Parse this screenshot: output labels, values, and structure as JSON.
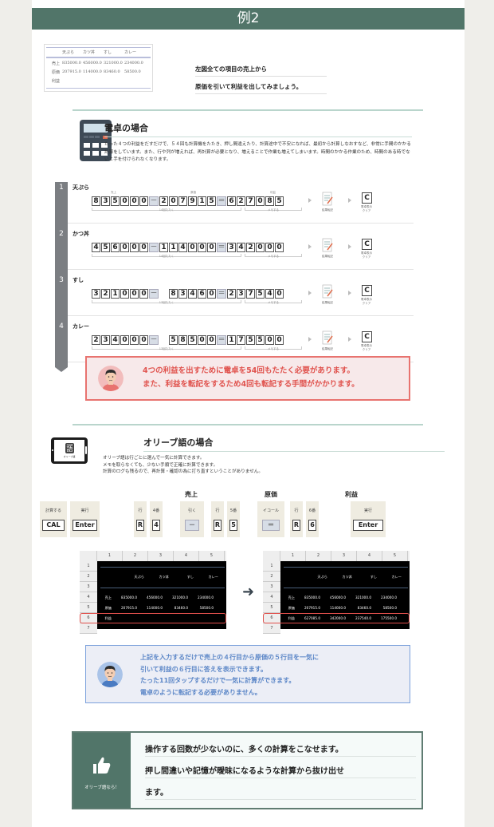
{
  "banner": {
    "title": "例2"
  },
  "intro": {
    "mini_table": {
      "headers": [
        "",
        "天ぷら",
        "カツ丼",
        "すし",
        "カレー"
      ],
      "rows": [
        [
          "売上",
          "835000.0",
          "456000.0",
          "321000.0",
          "234000.0"
        ],
        [
          "原価",
          "207915.0",
          "114000.0",
          "83460.0",
          "58500.0"
        ],
        [
          "利益",
          "",
          "",
          "",
          ""
        ]
      ]
    },
    "lines": [
      "左図全ての項目の売上から",
      "原価を引いて利益を出してみましょう。"
    ]
  },
  "calculator_section": {
    "title": "電卓の場合",
    "description": "たった４つの利益をだすだけで、５４回も計算機をたたき、押し間違えたり、計算途中で不安になれば、最初から計算しなおすなど、非常に手間のかかる計算をしています。また、行や列が増えれば、再計算が必要となり、増えることで作業も増えてしまいます。時間のかかる作業のため、時間のある時でないと手を付けられなくなります。",
    "label_sales": "売上",
    "label_cost": "原価",
    "label_profit": "利益",
    "minus": "－",
    "equals": "＝",
    "memo_label": "メモする",
    "transfer_label": "結果転記",
    "clear_key": "C",
    "clear_label_1": "電卓表示",
    "clear_label_2": "クリア",
    "steps": [
      {
        "num": "1",
        "name": "天ぷら",
        "sales": "835000",
        "cost": "207915",
        "profit": "627085",
        "taps": "14回たたく"
      },
      {
        "num": "2",
        "name": "かつ丼",
        "sales": "456000",
        "cost": "114000",
        "profit": "342000",
        "taps": "14回たたく"
      },
      {
        "num": "3",
        "name": "すし",
        "sales": "321000",
        "cost": "83460",
        "profit": "237540",
        "taps": "13回たたく"
      },
      {
        "num": "4",
        "name": "カレー",
        "sales": "234000",
        "cost": "58500",
        "profit": "175500",
        "taps": "13回たたく"
      }
    ],
    "callout": {
      "line1": "4つの利益を出すために電卓を54回もたたく必要があります。",
      "line2": "また、利益を転記をするため4回も転記する手間がかかります。",
      "color": "#e0524d"
    }
  },
  "olive_section": {
    "title": "オリーブ語の場合",
    "app_icon_glyph": "語",
    "app_icon_top": "OLIVE",
    "app_icon_label": "オリーブ語",
    "description_lines": [
      "オリーブ語は行ごとに選んで一気に計算できます。",
      "メモを取らなくても、少ない手順で正確に計算できます。",
      "計算のログも残るので、再計算・確認の為に打ち直すということがありません。"
    ],
    "group_labels": [
      "売上",
      "原価",
      "利益"
    ],
    "keys": [
      {
        "label": "計算する",
        "key": "CAL"
      },
      {
        "label": "実行",
        "key": "Enter"
      },
      {
        "label": "行",
        "key": "R"
      },
      {
        "label": "4番",
        "key": "4"
      },
      {
        "label": "引く",
        "key": "－"
      },
      {
        "label": "行",
        "key": "R"
      },
      {
        "label": "5番",
        "key": "5"
      },
      {
        "label": "イコール",
        "key": "＝"
      },
      {
        "label": "行",
        "key": "R"
      },
      {
        "label": "6番",
        "key": "6"
      },
      {
        "label": "実行",
        "key": "Enter"
      }
    ],
    "sheet": {
      "col_headers": [
        "1",
        "2",
        "3",
        "4",
        "5"
      ],
      "row_headers": [
        "1",
        "2",
        "3",
        "4",
        "5",
        "6",
        "7"
      ],
      "item_headers": [
        "天ぷら",
        "カツ丼",
        "すし",
        "カレー"
      ],
      "row_labels": {
        "sales": "売上",
        "cost": "原価",
        "profit": "利益"
      },
      "sales": [
        "835000.0",
        "456000.0",
        "321000.0",
        "234000.0"
      ],
      "cost": [
        "207915.0",
        "114000.0",
        "83460.0",
        "58500.0"
      ],
      "profit_after": [
        "627085.0",
        "342000.0",
        "237540.0",
        "175500.0"
      ]
    },
    "callout": {
      "lines": [
        "上記を入力するだけで売上の４行目から原価の５行目を一気に",
        "引いて利益の６行目に答えを表示できます。",
        "たった11回タップするだけで一気に計算ができます。",
        "電卓のように転記する必要がありません。"
      ],
      "color": "#5b86c7"
    }
  },
  "summary": {
    "side_label": "オリーブ語なら！",
    "lines": [
      "操作する回数が少ないのに、多くの計算をこなせます。",
      "押し間違いや記憶が曖昧になるような計算から抜け出せ",
      "ます。"
    ]
  }
}
